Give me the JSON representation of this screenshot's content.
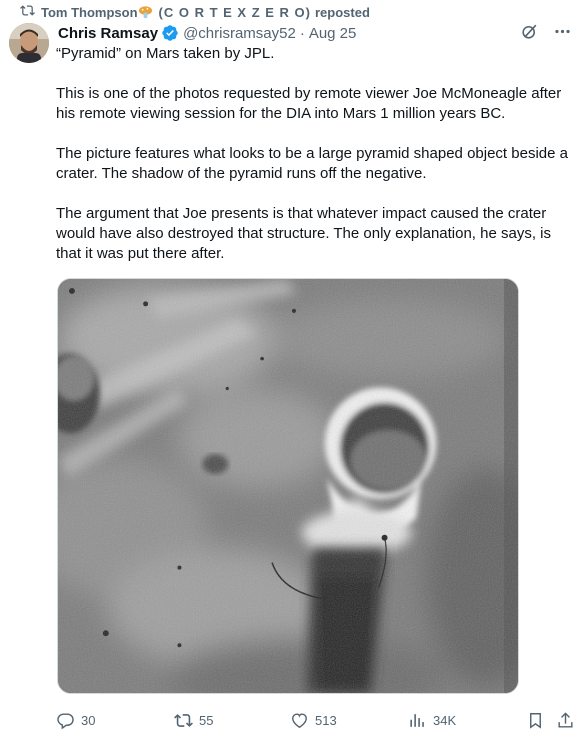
{
  "repost": {
    "name": "Tom Thompson",
    "emoji_icon": "mushroom-emoji",
    "handle_decor": "(C O R T E X  Z E R O)",
    "action": "reposted"
  },
  "tweet": {
    "author_name": "Chris Ramsay",
    "handle": "@chrisramsay52",
    "separator": "·",
    "date": "Aug 25",
    "paragraphs": [
      "“Pyramid” on Mars taken by JPL.",
      "This is one of the photos requested by remote viewer Joe McMoneagle after his remote viewing session for the DIA into Mars 1 million years BC.",
      "The picture features what looks to be a large pyramid shaped object beside a crater. The shadow of the pyramid runs off the negative.",
      "The argument that Joe presents is that whatever impact caused the crater would have also destroyed that structure. The only explanation, he says, is that it was put there after."
    ]
  },
  "stats": {
    "replies": "30",
    "reposts": "55",
    "likes": "513",
    "views": "34K"
  },
  "colors": {
    "text_primary": "#0f1419",
    "text_secondary": "#536471",
    "verified_blue": "#1d9bf0",
    "border": "#cfd9de"
  },
  "icons": {
    "repost": "repost-icon",
    "verified": "verified-badge-icon",
    "grok": "grok-icon",
    "more": "more-icon",
    "reply": "reply-icon",
    "like": "heart-icon",
    "views": "views-icon",
    "bookmark": "bookmark-icon",
    "share": "share-icon"
  }
}
